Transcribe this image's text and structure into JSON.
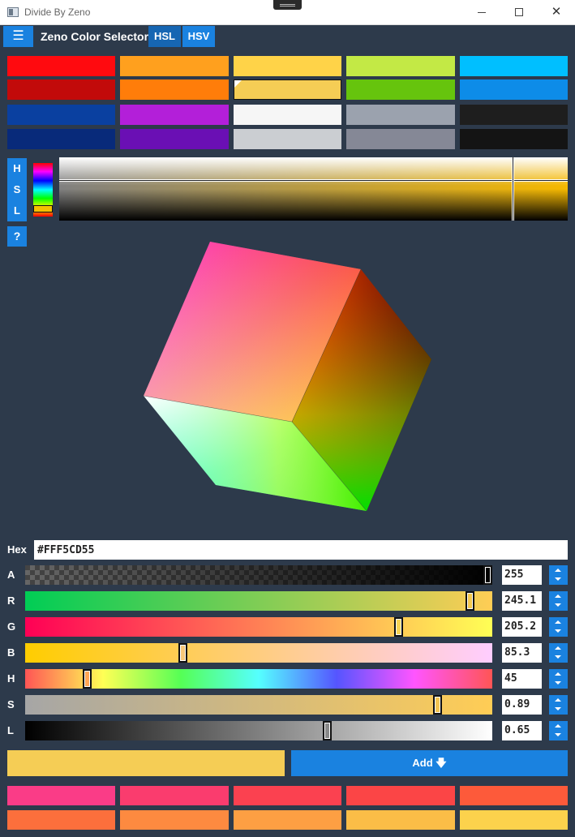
{
  "window": {
    "title": "Divide By Zeno",
    "app_icon": "window-icon",
    "grip_icon": "title-grip-icon",
    "minimize_icon": "minimize-icon",
    "maximize_icon": "maximize-icon",
    "close_icon": "close-icon",
    "close_glyph": "✕"
  },
  "toolbar": {
    "menu_glyph": "☰",
    "app_name": "Zeno Color Selector",
    "modes": [
      "HSL",
      "HSV"
    ],
    "active_mode": "HSL"
  },
  "palette": {
    "rows": [
      [
        "#ff0a0f",
        "#ffa01e",
        "#ffd348",
        "#c3e945",
        "#00bfff"
      ],
      [
        "#c20a0a",
        "#ff7d0a",
        "#f5cd55",
        "#66c40d",
        "#0d8ce8"
      ],
      [
        "#0a40a0",
        "#b31fd9",
        "#f6f6f6",
        "#9ba2ae",
        "#1e1e1e"
      ],
      [
        "#082a7a",
        "#6a0fb4",
        "#cbced2",
        "#858896",
        "#141414"
      ]
    ],
    "selected": [
      1,
      2
    ]
  },
  "hsl_buttons": [
    "H",
    "S",
    "L"
  ],
  "help_label": "?",
  "hex": {
    "label": "Hex",
    "value": "#FFF5CD55"
  },
  "sliders": [
    {
      "label": "A",
      "value": "255",
      "fraction": 1.0
    },
    {
      "label": "R",
      "value": "245.1",
      "fraction": 0.961
    },
    {
      "label": "G",
      "value": "205.2",
      "fraction": 0.805
    },
    {
      "label": "B",
      "value": "85.3",
      "fraction": 0.335
    },
    {
      "label": "H",
      "value": "45",
      "fraction": 0.125
    },
    {
      "label": "S",
      "value": "0.89",
      "fraction": 0.89
    },
    {
      "label": "L",
      "value": "0.65",
      "fraction": 0.65
    }
  ],
  "preview_color": "#f5cd55",
  "add_button": {
    "label": "Add 🡇"
  },
  "recent_colors": {
    "rows": [
      [
        "#fa3c87",
        "#fa3c6e",
        "#fb4150",
        "#fb4546",
        "#fd5a3a"
      ],
      [
        "#fc6f3c",
        "#fd8a40",
        "#fd9f43",
        "#fbbd47",
        "#fcd24c"
      ]
    ]
  }
}
